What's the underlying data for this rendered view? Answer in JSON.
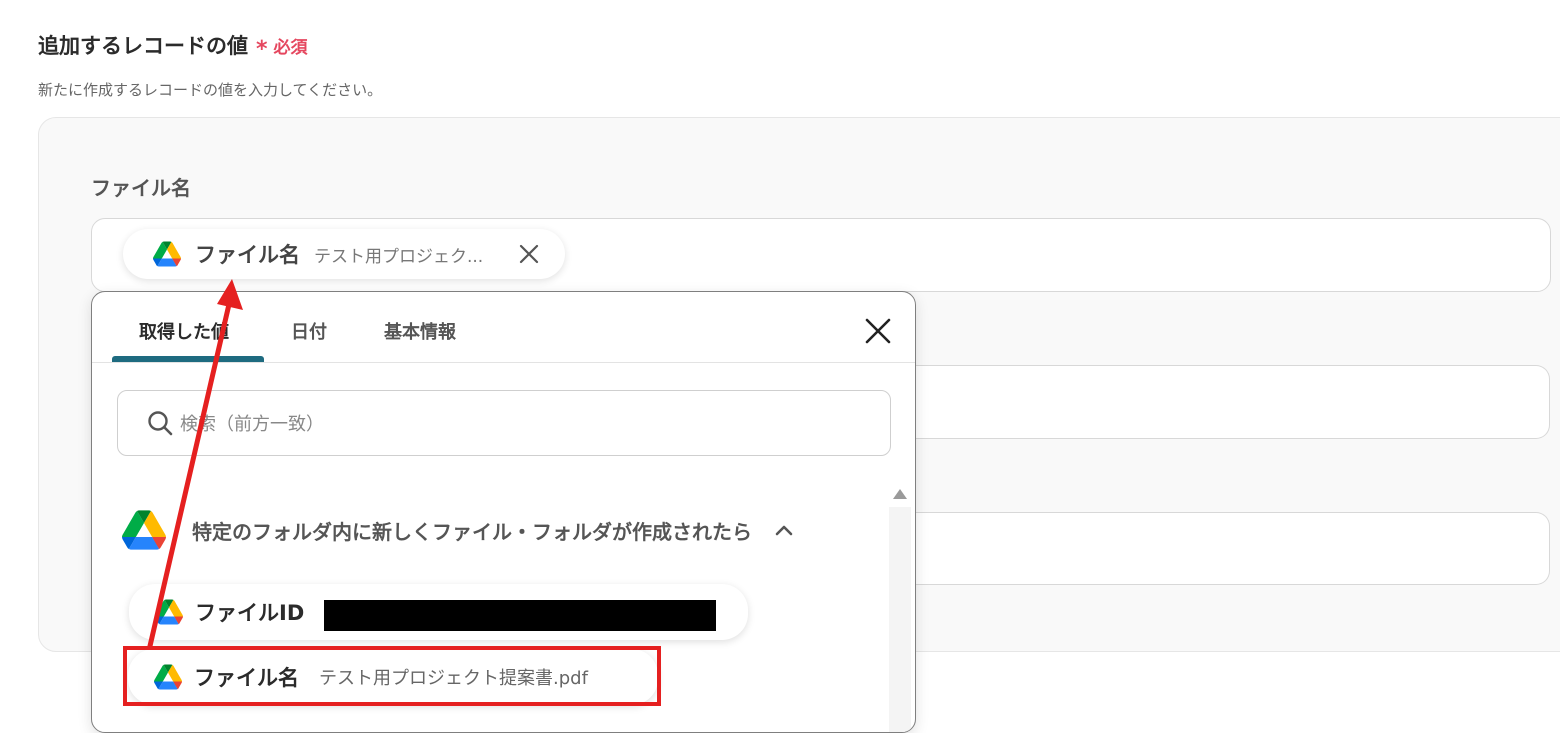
{
  "section": {
    "title": "追加するレコードの値",
    "required_mark": "*",
    "required_label": "必須",
    "description": "新たに作成するレコードの値を入力してください。"
  },
  "field": {
    "label": "ファイル名",
    "chip_label": "ファイル名",
    "chip_value": "テスト用プロジェク..."
  },
  "popover": {
    "tabs": [
      {
        "label": "取得した値",
        "active": true
      },
      {
        "label": "日付",
        "active": false
      },
      {
        "label": "基本情報",
        "active": false
      }
    ],
    "search_placeholder": "検索（前方一致）",
    "group_title": "特定のフォルダ内に新しくファイル・フォルダが作成されたら",
    "items": [
      {
        "label": "ファイルID",
        "value": ""
      },
      {
        "label": "ファイル名",
        "value": "テスト用プロジェクト提案書.pdf"
      }
    ]
  },
  "colors": {
    "accent": "#1e6b80",
    "required": "#e5475f",
    "annotation": "#e52020"
  },
  "icons": {
    "app": "google-drive-icon",
    "close": "close-icon",
    "search": "search-icon",
    "collapse": "chevron-up-icon"
  }
}
